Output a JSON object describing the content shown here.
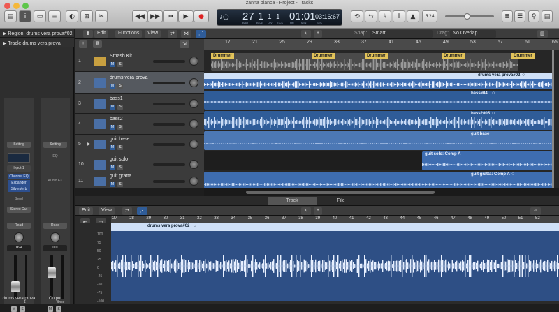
{
  "window": {
    "title": "zanna bianca - Project - Tracks"
  },
  "toolbar": {
    "lcd": {
      "bar": "27",
      "beat": "1",
      "div": "1",
      "tick": "1",
      "time": "01:01",
      "sub": "03:16:67",
      "labels": [
        "BAR",
        "BEAT",
        "DIV",
        "TICK",
        "HR",
        "MIN",
        "SEC"
      ]
    },
    "key": "∃ 24",
    "left_icons": [
      "library-icon",
      "info-icon",
      "toolbar-icon",
      "smart-controls-icon",
      "mixer-icon",
      "editors-icon"
    ],
    "transport": [
      "◀◀",
      "▶▶",
      "▏◀",
      "▶",
      "●"
    ]
  },
  "inspector": {
    "region": "Region: drums vera prova#02",
    "track": "Track:  drums vera prova",
    "strip1": {
      "setting": "Setting",
      "eq": "",
      "input": "Input 1",
      "plugins": [
        "Channel EQ",
        "Expander",
        "SilverVerb"
      ],
      "send": "Send",
      "output": "Stereo Out",
      "read": "Read",
      "value": "16.4",
      "name": "drums vera prova",
      "meter": "1"
    },
    "strip2": {
      "setting": "Setting",
      "eq": "EQ",
      "audio_fx": "Audio FX",
      "read": "Read",
      "value": "0.0",
      "name": "Output",
      "meter": "Bnce"
    }
  },
  "tracks_header": {
    "edit": "Edit",
    "functions": "Functions",
    "view": "View",
    "snap_label": "Snap:",
    "snap": "Smart",
    "drag_label": "Drag:",
    "drag": "No Overlap"
  },
  "tracks": [
    {
      "num": "1",
      "name": "Smash Kit"
    },
    {
      "num": "2",
      "name": "drums vera prova"
    },
    {
      "num": "3",
      "name": "bass1"
    },
    {
      "num": "4",
      "name": "bass2"
    },
    {
      "num": "5",
      "name": "guit base"
    },
    {
      "num": "10",
      "name": "guit solo"
    },
    {
      "num": "11",
      "name": "guit gratta"
    }
  ],
  "ruler": [
    "17",
    "21",
    "25",
    "29",
    "33",
    "37",
    "41",
    "45",
    "49",
    "53",
    "57",
    "61",
    "65"
  ],
  "regions": {
    "drummer": "Drummer",
    "r2": "drums vera prova#02",
    "r3": "bass#04",
    "r4": "bass2#05",
    "r5": "guit base",
    "r6": "guit solo: Comp A",
    "r7": "guit gratta: Comp A"
  },
  "tabs": [
    "Track",
    "File"
  ],
  "editor": {
    "edit": "Edit",
    "view": "View",
    "region": "drums vera prova#02",
    "ruler": [
      "27",
      "28",
      "29",
      "30",
      "31",
      "32",
      "33",
      "34",
      "35",
      "36",
      "37",
      "38",
      "39",
      "40",
      "41",
      "42",
      "43",
      "44",
      "45",
      "46",
      "47",
      "48",
      "49",
      "50",
      "51",
      "52"
    ],
    "scale": [
      "100",
      "75",
      "50",
      "25",
      "0",
      "-25",
      "-50",
      "-75",
      "-100"
    ]
  },
  "colors": {
    "accent": "#2f5c98",
    "region": "#3e6db0",
    "drummer": "#e2c35a",
    "wave_edit": "#2e4f85"
  }
}
